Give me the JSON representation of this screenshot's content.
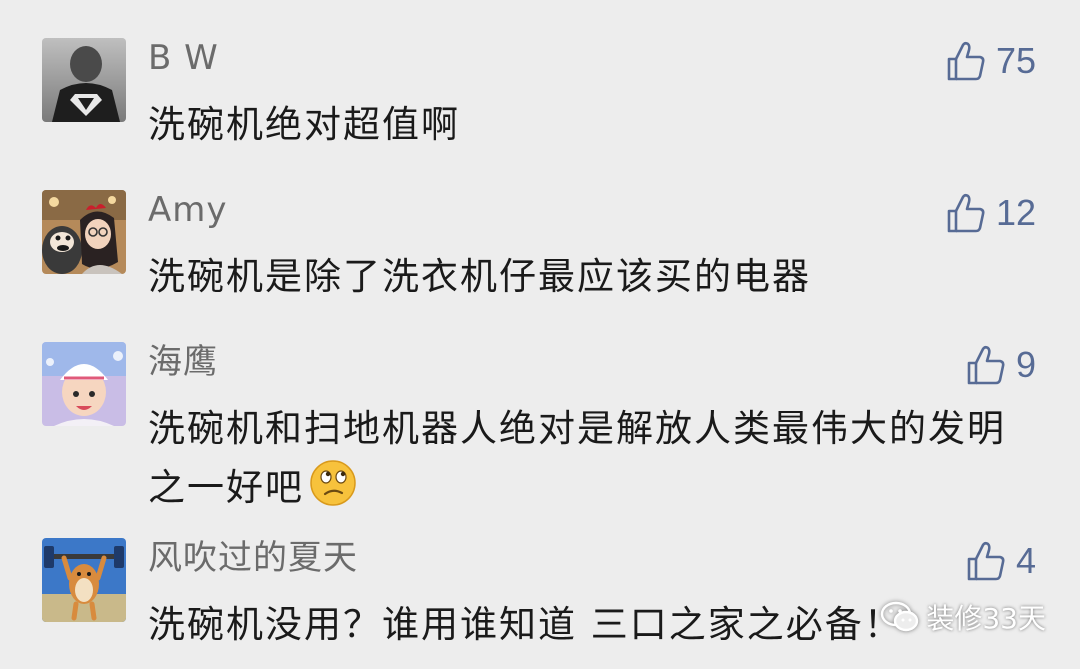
{
  "comments": [
    {
      "username": "B W",
      "text": "洗碗机绝对超值啊",
      "likes": "75",
      "avatar": "superman-kid-avatar"
    },
    {
      "username": "Amy",
      "text": "洗碗机是除了洗衣机仔最应该买的电器",
      "likes": "12",
      "avatar": "woman-with-plush-avatar"
    },
    {
      "username": "海鹰",
      "text": "洗碗机和扫地机器人绝对是解放人类最伟大的发明之一好吧",
      "likes": "9",
      "avatar": "child-with-hat-avatar",
      "emoji": "thinking-face-emoji"
    },
    {
      "username": "风吹过的夏天",
      "text": "洗碗机没用？谁用谁知道 三口之家之必备！",
      "likes": "4",
      "avatar": "weightlifting-hamster-avatar"
    }
  ],
  "watermark": {
    "text": "装修33天",
    "icon": "wechat-icon"
  },
  "colors": {
    "background": "#ededed",
    "like_blue": "#576b95",
    "username_gray": "#6b6b6b"
  }
}
